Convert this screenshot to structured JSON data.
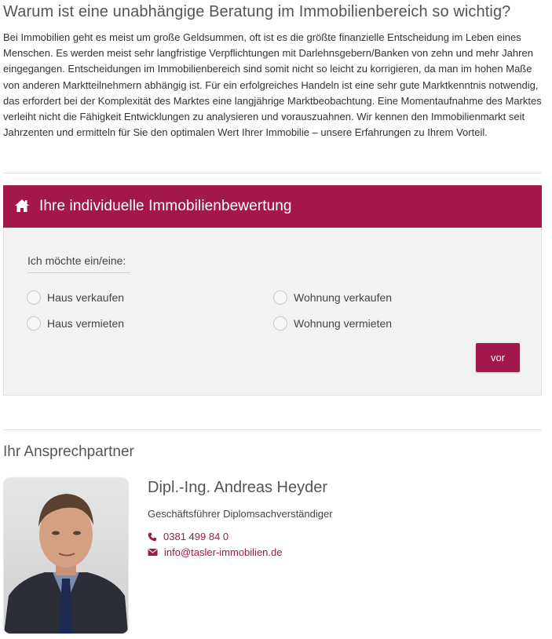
{
  "intro": {
    "heading": "Warum ist eine unabhängige Beratung im Immobilienbereich so wichtig?",
    "text": "Bei Immobilien geht es meist um große Geldsummen, oft ist es die größte finanzielle Entscheidung im Leben eines Menschen. Es werden meist sehr langfristige Verpflichtungen mit Darlehnsgebern/Banken von zehn und mehr Jahren eingegangen. Entscheidungen im Immobilienbereich sind somit nicht so leicht zu korrigieren, da man im hohen Maße von anderen Marktteilnehmern abhängig ist. Für ein erfolgreiches Handeln ist eine sehr gute Marktkenntnis notwendig, das erfordert bei der Komplexität des Marktes eine langjährige Marktbeobachtung. Eine Momentaufnahme des Marktes verleiht nicht die Fähigkeit Entwicklungen zu analysieren und vorauszuahnen. Wir kennen den Immobilienmarkt seit Jahrzenten und ermitteln für Sie den optimalen Wert Ihrer Immobilie – unsere Erfahrungen zu Ihrem Vorteil."
  },
  "valuation": {
    "title": "Ihre individuelle Immobilienbewertung",
    "icon": "home-icon",
    "question": "Ich möchte ein/eine:",
    "options": [
      {
        "label": "Haus verkaufen",
        "selected": false
      },
      {
        "label": "Wohnung verkaufen",
        "selected": false
      },
      {
        "label": "Haus vermieten",
        "selected": false
      },
      {
        "label": "Wohnung vermieten",
        "selected": false
      }
    ],
    "next_label": "vor"
  },
  "contact": {
    "heading": "Ihr Ansprechpartner",
    "name": "Dipl.-Ing. Andreas Heyder",
    "role": "Geschäftsführer Diplomsachverständiger",
    "phone": "0381 499 84 0",
    "email": "info@tasler-immobilien.de",
    "phone_icon": "phone-icon",
    "email_icon": "envelope-icon"
  },
  "colors": {
    "accent": "#a2184d",
    "panel_bg": "#f2f2f2",
    "text": "#333333"
  }
}
